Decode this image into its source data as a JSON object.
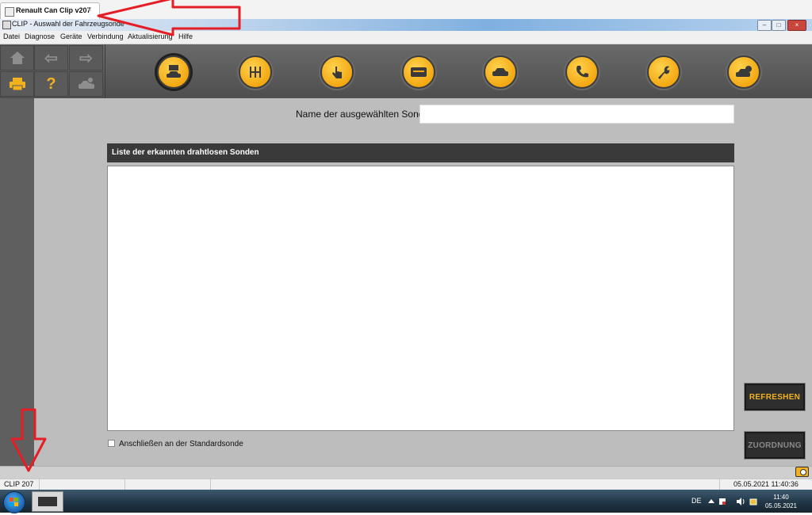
{
  "browser_tab": {
    "title": "Renault Can Clip v207",
    "close": "×"
  },
  "window": {
    "title": "CLIP - Auswahl der Fahrzeugsonde",
    "buttons": [
      "–",
      "□",
      "×"
    ]
  },
  "menu": [
    "Datei",
    "Diagnose",
    "Geräte",
    "Verbindung",
    "Aktualisierung",
    "Hilfe"
  ],
  "toolbar": {
    "nav": [
      "home-icon",
      "back-arrow-icon",
      "forward-arrow-icon",
      "printer-icon",
      "help-icon",
      "vehicle-alert-icon"
    ],
    "modules": [
      "vehicle-diagnostic-icon",
      "gearbox-icon",
      "touch-icon",
      "card-icon",
      "car-tools-icon",
      "phone-icon",
      "wrench-icon",
      "vehicle-check-icon"
    ],
    "nav_glyphs": {
      "back": "⇦",
      "forward": "⇨",
      "help": "?"
    }
  },
  "main": {
    "probe_name_label": "Name der ausgewählten Sonde",
    "probe_name_value": "",
    "list_header": "Liste der erkannten drahtlosen Sonden",
    "probes": [],
    "std_probe_label": "Anschließen an der Standardsonde",
    "std_probe_checked": false,
    "refresh_button": "REFRESHEN",
    "assign_button": "ZUORDNUNG",
    "assign_enabled": false
  },
  "statusbar": {
    "product": "CLIP 207",
    "datetime": "05.05.2021 11:40:36"
  },
  "taskbar": {
    "language": "DE",
    "time": "11:40",
    "date": "05.05.2021"
  },
  "colors": {
    "accent": "#f1b21e",
    "toolbar": "#555555",
    "content": "#bdbdbd",
    "annotation": "#e41e26"
  }
}
